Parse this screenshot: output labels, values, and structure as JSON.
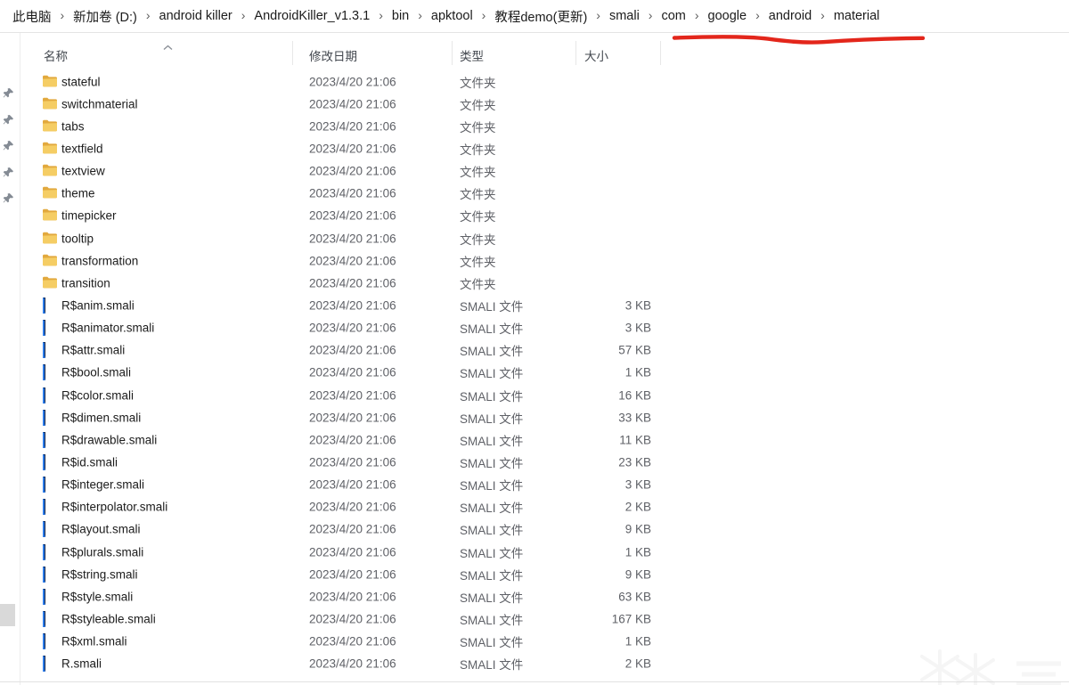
{
  "breadcrumb": {
    "items": [
      "此电脑",
      "新加卷 (D:)",
      "android killer",
      "AndroidKiller_v1.3.1",
      "bin",
      "apktool",
      "教程demo(更新)",
      "smali",
      "com",
      "google",
      "android",
      "material"
    ],
    "separator": "›"
  },
  "annotation": {
    "description": "red hand-drawn underline under com > google > android > material",
    "color": "#e3261b"
  },
  "columns": {
    "name": "名称",
    "modified": "修改日期",
    "type": "类型",
    "size": "大小"
  },
  "sort": {
    "column": "名称",
    "direction": "ascending"
  },
  "items": [
    {
      "name": "stateful",
      "kind": "folder",
      "date": "2023/4/20 21:06",
      "type": "文件夹",
      "size": ""
    },
    {
      "name": "switchmaterial",
      "kind": "folder",
      "date": "2023/4/20 21:06",
      "type": "文件夹",
      "size": ""
    },
    {
      "name": "tabs",
      "kind": "folder",
      "date": "2023/4/20 21:06",
      "type": "文件夹",
      "size": ""
    },
    {
      "name": "textfield",
      "kind": "folder",
      "date": "2023/4/20 21:06",
      "type": "文件夹",
      "size": ""
    },
    {
      "name": "textview",
      "kind": "folder",
      "date": "2023/4/20 21:06",
      "type": "文件夹",
      "size": ""
    },
    {
      "name": "theme",
      "kind": "folder",
      "date": "2023/4/20 21:06",
      "type": "文件夹",
      "size": ""
    },
    {
      "name": "timepicker",
      "kind": "folder",
      "date": "2023/4/20 21:06",
      "type": "文件夹",
      "size": ""
    },
    {
      "name": "tooltip",
      "kind": "folder",
      "date": "2023/4/20 21:06",
      "type": "文件夹",
      "size": ""
    },
    {
      "name": "transformation",
      "kind": "folder",
      "date": "2023/4/20 21:06",
      "type": "文件夹",
      "size": ""
    },
    {
      "name": "transition",
      "kind": "folder",
      "date": "2023/4/20 21:06",
      "type": "文件夹",
      "size": ""
    },
    {
      "name": "R$anim.smali",
      "kind": "smali",
      "date": "2023/4/20 21:06",
      "type": "SMALI 文件",
      "size": "3 KB"
    },
    {
      "name": "R$animator.smali",
      "kind": "smali",
      "date": "2023/4/20 21:06",
      "type": "SMALI 文件",
      "size": "3 KB"
    },
    {
      "name": "R$attr.smali",
      "kind": "smali",
      "date": "2023/4/20 21:06",
      "type": "SMALI 文件",
      "size": "57 KB"
    },
    {
      "name": "R$bool.smali",
      "kind": "smali",
      "date": "2023/4/20 21:06",
      "type": "SMALI 文件",
      "size": "1 KB"
    },
    {
      "name": "R$color.smali",
      "kind": "smali",
      "date": "2023/4/20 21:06",
      "type": "SMALI 文件",
      "size": "16 KB"
    },
    {
      "name": "R$dimen.smali",
      "kind": "smali",
      "date": "2023/4/20 21:06",
      "type": "SMALI 文件",
      "size": "33 KB"
    },
    {
      "name": "R$drawable.smali",
      "kind": "smali",
      "date": "2023/4/20 21:06",
      "type": "SMALI 文件",
      "size": "11 KB"
    },
    {
      "name": "R$id.smali",
      "kind": "smali",
      "date": "2023/4/20 21:06",
      "type": "SMALI 文件",
      "size": "23 KB"
    },
    {
      "name": "R$integer.smali",
      "kind": "smali",
      "date": "2023/4/20 21:06",
      "type": "SMALI 文件",
      "size": "3 KB"
    },
    {
      "name": "R$interpolator.smali",
      "kind": "smali",
      "date": "2023/4/20 21:06",
      "type": "SMALI 文件",
      "size": "2 KB"
    },
    {
      "name": "R$layout.smali",
      "kind": "smali",
      "date": "2023/4/20 21:06",
      "type": "SMALI 文件",
      "size": "9 KB"
    },
    {
      "name": "R$plurals.smali",
      "kind": "smali",
      "date": "2023/4/20 21:06",
      "type": "SMALI 文件",
      "size": "1 KB"
    },
    {
      "name": "R$string.smali",
      "kind": "smali",
      "date": "2023/4/20 21:06",
      "type": "SMALI 文件",
      "size": "9 KB"
    },
    {
      "name": "R$style.smali",
      "kind": "smali",
      "date": "2023/4/20 21:06",
      "type": "SMALI 文件",
      "size": "63 KB"
    },
    {
      "name": "R$styleable.smali",
      "kind": "smali",
      "date": "2023/4/20 21:06",
      "type": "SMALI 文件",
      "size": "167 KB"
    },
    {
      "name": "R$xml.smali",
      "kind": "smali",
      "date": "2023/4/20 21:06",
      "type": "SMALI 文件",
      "size": "1 KB"
    },
    {
      "name": "R.smali",
      "kind": "smali",
      "date": "2023/4/20 21:06",
      "type": "SMALI 文件",
      "size": "2 KB"
    }
  ],
  "nav_pane": {
    "pinned_count": 5
  },
  "icons": {
    "folder": "folder-icon",
    "smali": "intellij-file-icon",
    "pin": "pushpin-icon",
    "sort": "chevron-up-icon"
  },
  "colors": {
    "annotation_red": "#e3261b",
    "folder_front": "#f5cd64",
    "folder_back": "#e2a93e",
    "smali_icon_blue": "#2e7ce8",
    "header_text": "#43484f",
    "secondary_text": "#5f6167"
  }
}
